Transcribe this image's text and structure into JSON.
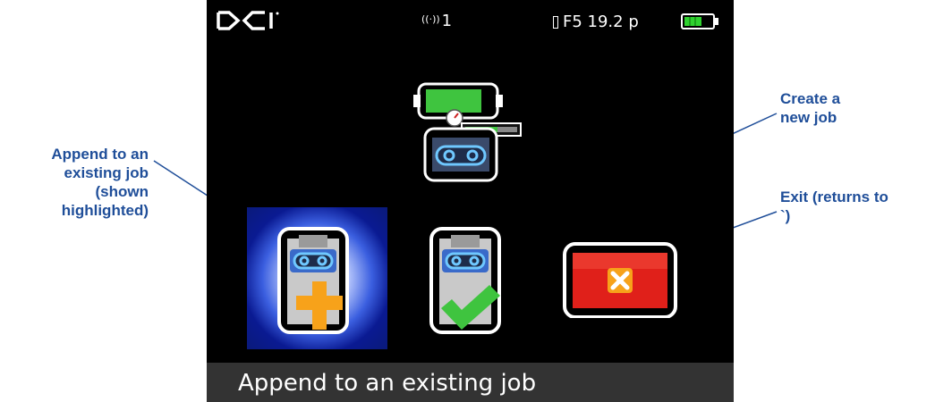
{
  "callouts": {
    "append": [
      "Append to an",
      "existing job",
      "(shown",
      "highlighted)"
    ],
    "create": [
      "Create a",
      "new job"
    ],
    "exit": [
      "Exit (returns to",
      "`)"
    ]
  },
  "status_bar": {
    "logo": "DCI",
    "signal_value": "1",
    "frequency_text": "F5 19.2 p",
    "battery_color": "#2fd12f"
  },
  "menu": {
    "options": [
      {
        "label": "Append to an existing job",
        "selected": true
      },
      {
        "label": "Create a new job",
        "selected": false
      },
      {
        "label": "Exit",
        "selected": false
      }
    ]
  },
  "footer": {
    "text": "Append to an existing job"
  },
  "colors": {
    "callout_text": "#1f4e99",
    "arrow": "#1f4e99",
    "highlight": "#0a1a92",
    "exit_red": "#e0201a",
    "plus_orange": "#f7a21a",
    "check_green": "#3fc43f"
  }
}
